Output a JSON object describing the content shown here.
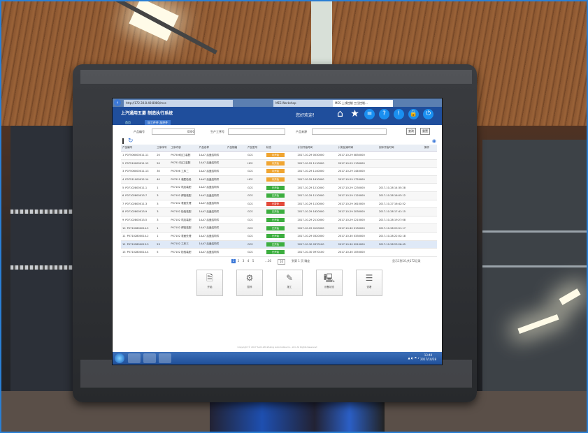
{
  "browser": {
    "tabs": [
      "http://172.30.8.40:8080/mes",
      "MES Workshop",
      "MES 上线控制 工位控制..."
    ],
    "active_tab": "MES 上线控制 工位控制..."
  },
  "app": {
    "logo": "上汽通用五菱 制造执行系统",
    "home_tab": "首页",
    "module_tab": "加工件件 加控件",
    "welcome": "您好欢迎！"
  },
  "filters": {
    "product_no_label": "产品编号",
    "product_no_value": "0000",
    "process_label": "生产工序号",
    "source_label": "产品来源",
    "query_button": "查询",
    "reset_button": "重置"
  },
  "table": {
    "columns": [
      "产品编号",
      "工序序号",
      "工序内容",
      "产品名称",
      "产品规格",
      "产品型号",
      "状态",
      "计划开始时间",
      "计划结束时间",
      "实际开始时间",
      "操作"
    ],
    "rows": [
      {
        "n": "1",
        "code": "P07506000011-11",
        "seq": "20",
        "op": "P07506加工装配",
        "name": "1AA7 后盖结构件",
        "spec": "",
        "model": "GCS",
        "status": "未开始",
        "status_color": "orange",
        "plan_start": "2017-10-29 0030000",
        "plan_end": "2017-10-29 0830000",
        "act_start": ""
      },
      {
        "n": "2",
        "code": "P07510000011-12",
        "seq": "20",
        "op": "P07510加工装配",
        "name": "1AA7 后盖结构件",
        "spec": "",
        "model": "HCS",
        "status": "未开始",
        "status_color": "orange",
        "plan_start": "2017-10-29 1110000",
        "plan_end": "2017-10-29 1130000",
        "act_start": ""
      },
      {
        "n": "3",
        "code": "P07506000011-13",
        "seq": "30",
        "op": "P07506 工序二",
        "name": "1AA7 后盖结构件",
        "spec": "",
        "model": "GCS",
        "status": "未开始",
        "status_color": "orange",
        "plan_start": "2017-10-29 1140000",
        "plan_end": "2017-10-29 1440000",
        "act_start": ""
      },
      {
        "n": "4",
        "code": "P07511000012-14",
        "seq": "40",
        "op": "P07511 装配检验",
        "name": "1AA7 后盖结构件",
        "spec": "",
        "model": "HCS",
        "status": "未开始",
        "status_color": "orange",
        "plan_start": "2017-10-29 1610000",
        "plan_end": "2017-10-29 1720000",
        "act_start": ""
      },
      {
        "n": "5",
        "code": "P07102800011-1",
        "seq": "1",
        "op": "P07102 机加装配",
        "name": "1AA7 后盖结构件",
        "spec": "",
        "model": "GCS",
        "status": "已开始",
        "status_color": "green",
        "plan_start": "2017-10-29 1210000",
        "plan_end": "2017-10-29 1230000",
        "act_start": "2017-10-28 14:35:28"
      },
      {
        "n": "6",
        "code": "P07102800013-7",
        "seq": "3",
        "op": "P07102 焊接装配",
        "name": "1AA7 后盖结构件",
        "spec": "",
        "model": "GCS",
        "status": "已开始",
        "status_color": "green",
        "plan_start": "2017-10-29 1110000",
        "plan_end": "2017-10-29 1120000",
        "act_start": "2017-10-28 16:03:12"
      },
      {
        "n": "7",
        "code": "P07102800011-3",
        "seq": "3",
        "op": "P07102 表面处理",
        "name": "1AA7 后盖结构件",
        "spec": "",
        "model": "GCS",
        "status": "已暂停",
        "status_color": "red",
        "plan_start": "2017-10-29 1130000",
        "plan_end": "2017-10-29 1610000",
        "act_start": "2017-10-27 16:42:52"
      },
      {
        "n": "8",
        "code": "P07102800013-9",
        "seq": "3",
        "op": "P07102 检验装配",
        "name": "1AA7 后盖结构件",
        "spec": "",
        "model": "GCS",
        "status": "已开始",
        "status_color": "green",
        "plan_start": "2017-10-29 1620000",
        "plan_end": "2017-10-29 2030000",
        "act_start": "2017-10-28 17:41:15"
      },
      {
        "n": "9",
        "code": "P07102800013-5",
        "seq": "3",
        "op": "P07102 机加装配",
        "name": "1AA7 后盖结构件",
        "spec": "",
        "model": "GCS",
        "status": "已开始",
        "status_color": "green",
        "plan_start": "2017-10-29 2110000",
        "plan_end": "2017-10-29 2210000",
        "act_start": "2017-10-28 19:27:08"
      },
      {
        "n": "10",
        "code": "P07102800014-5",
        "seq": "1",
        "op": "P07102 焊接装配",
        "name": "1AA7 后盖结构件",
        "spec": "",
        "model": "GCS",
        "status": "已开始",
        "status_color": "green",
        "plan_start": "2017-10-29 0120000",
        "plan_end": "2017-10-30 0130000",
        "act_start": "2017-10-28 20:51:17"
      },
      {
        "n": "11",
        "code": "P07102800014-2",
        "seq": "1",
        "op": "P07102 表面处理",
        "name": "1AA7 后盖结构件",
        "spec": "",
        "model": "GCS",
        "status": "已开始",
        "status_color": "green",
        "plan_start": "2017-10-29 0320000",
        "plan_end": "2017-10-30 0330000",
        "act_start": "2017-10-28 22:02:18"
      },
      {
        "n": "12",
        "code": "P07102800013-3",
        "seq": "23",
        "op": "P07102 工序三",
        "name": "1AA7 后盖结构件",
        "spec": "",
        "model": "GCS",
        "status": "已开始",
        "status_color": "green",
        "plan_start": "2017-10-30 0370100",
        "plan_end": "2017-10-30 0910000",
        "act_start": "2017-10-28 23:26:45"
      },
      {
        "n": "13",
        "code": "P07102800014-4",
        "seq": "5",
        "op": "P07102 检验装配",
        "name": "1AA7 后盖结构件",
        "spec": "",
        "model": "GCS",
        "status": "已开始",
        "status_color": "green",
        "plan_start": "2017-10-30 0970100",
        "plan_end": "2017-10-30 1050000",
        "act_start": ""
      }
    ]
  },
  "pager": {
    "pages": [
      "1",
      "2",
      "3",
      "4",
      "5"
    ],
    "current": "1",
    "next": "...16",
    "page_size": "10",
    "goto": "到第 1 页 确定",
    "summary": "显示1到10,共172记录"
  },
  "actions": [
    {
      "label": "开始",
      "icon": "document-icon",
      "glyph": "🗎"
    },
    {
      "label": "暂停",
      "icon": "gear-icon",
      "glyph": "⚙"
    },
    {
      "label": "报工",
      "icon": "edit-icon",
      "glyph": "✎"
    },
    {
      "label": "设备状态",
      "icon": "computer-icon",
      "glyph": "🖳"
    },
    {
      "label": "查看",
      "icon": "list-icon",
      "glyph": "☰"
    }
  ],
  "footer": {
    "copyright": "Copyright © 2017 SAIC-GM-Wuling Automobile Co., Ltd. All Rights Reserved"
  },
  "taskbar": {
    "time": "13:40",
    "date": "2017/10/28"
  }
}
